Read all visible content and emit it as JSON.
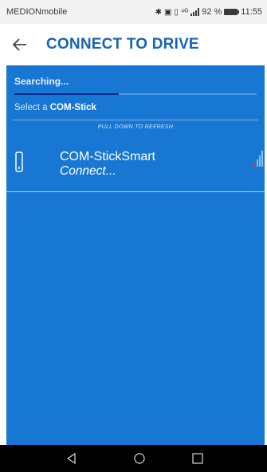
{
  "status_bar": {
    "carrier": "MEDIONmobile",
    "battery_percent": "92 %",
    "time": "11:55",
    "icons": [
      "bluetooth-icon",
      "nfc-icon",
      "vibrate-icon",
      "network-4g-icon",
      "signal-icon",
      "battery-icon"
    ]
  },
  "app_bar": {
    "back_icon": "arrow-left-icon",
    "title": "CONNECT TO DRIVE"
  },
  "scan": {
    "status": "Searching...",
    "progress_fraction": 0.43,
    "prompt_prefix": "Select a ",
    "prompt_strong": "COM-Stick",
    "pull_hint": "PULL DOWN TO REFRESH"
  },
  "devices": [
    {
      "name": "COM-StickSmart",
      "action": "Connect...",
      "icon": "usb-stick-icon",
      "signal_icon": "signal-strength-icon"
    }
  ],
  "nav": {
    "back": "nav-back-icon",
    "home": "nav-home-icon",
    "recents": "nav-recents-icon"
  },
  "colors": {
    "accent": "#1565b5",
    "panel": "#1877d2",
    "progress": "#0a2a8c",
    "signal_low": "#e53935"
  }
}
